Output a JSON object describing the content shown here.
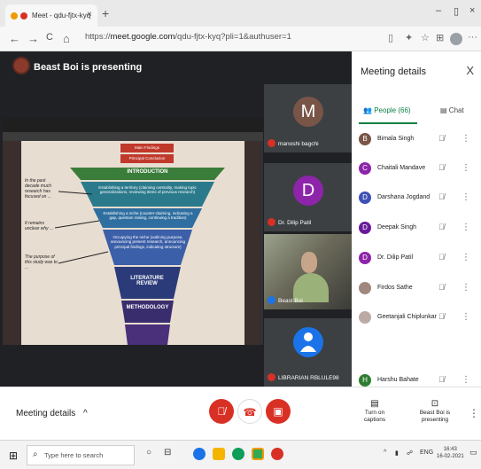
{
  "browser": {
    "tab_title": "Meet - qdu-fjtx-kyq",
    "tab_close": "×",
    "new_tab": "+",
    "url_prefix": "https://",
    "url_host": "meet.google.com",
    "url_rest": "/qdu-fjtx-kyq?pli=1&authuser=1",
    "win_min": "–",
    "win_max": "▯",
    "win_close": "×",
    "nav_back": "←",
    "nav_forward": "→",
    "nav_reload": "C",
    "nav_home": "⌂",
    "lock": "🔒",
    "more_tools": "···"
  },
  "stage": {
    "presenter_label": "Beast Boi is presenting",
    "slide": {
      "intro": "INTRODUCTION",
      "lit": "LITERATURE REVIEW",
      "meth": "METHODOLOGY",
      "box1": "Main Findings",
      "box2": "Principal Conclusion",
      "band1": "Establishing a territory (claiming centrality, making topic generalizations, reviewing items of previous research)",
      "band2": "Establishing a niche (counter-claiming, indicating a gap, question raising, continuing a tradition)",
      "band3": "Occupying the niche (outlining purpose, announcing present research, announcing principal findings, indicating structure)",
      "note1": "In the past decade much research has focused on ...",
      "note2": "It remains unclear why ...",
      "note3": "The purpose of this study was to ..."
    },
    "tiles": [
      {
        "name": "manoshi bagchi",
        "initial": "M",
        "color": "#795548"
      },
      {
        "name": "Dr. Dilip Patil",
        "initial": "D",
        "color": "#8e24aa"
      },
      {
        "name": "Beast Boi",
        "initial": "",
        "color": "#3c4043"
      },
      {
        "name": "LIBRARIAN RBLULE98",
        "initial": "",
        "color": "#1a73e8"
      }
    ]
  },
  "panel": {
    "title": "Meeting details",
    "close": "X",
    "tab_people": "People (66)",
    "tab_chat": "Chat",
    "participants": [
      {
        "name": "Bimala Singh",
        "initial": "B",
        "color": "#795548"
      },
      {
        "name": "Chaitali Mandave",
        "initial": "C",
        "color": "#8e24aa"
      },
      {
        "name": "Darshana Jogdand",
        "initial": "D",
        "color": "#3f51b5"
      },
      {
        "name": "Deepak Singh",
        "initial": "D",
        "color": "#6a1b9a"
      },
      {
        "name": "Dr. Dilip Patil",
        "initial": "D",
        "color": "#8e24aa"
      },
      {
        "name": "Firdos Sathe",
        "initial": "",
        "color": "#a1887f"
      },
      {
        "name": "Geetanjali Chiplunkar",
        "initial": "",
        "color": "#bcaaa4"
      },
      {
        "name": "Harshu Bahate",
        "initial": "H",
        "color": "#2e7d32"
      }
    ]
  },
  "bottom": {
    "meeting_details": "Meeting details",
    "chevron": "^",
    "captions": "Turn on captions",
    "presenting": "Beast Boi is presenting",
    "more": "⋮"
  },
  "taskbar": {
    "search_placeholder": "Type here to search",
    "lang": "ENG",
    "time": "16:43",
    "date": "16-02-2021"
  },
  "colors": {
    "meet_green": "#0b8043",
    "end_call_red": "#d93025"
  }
}
